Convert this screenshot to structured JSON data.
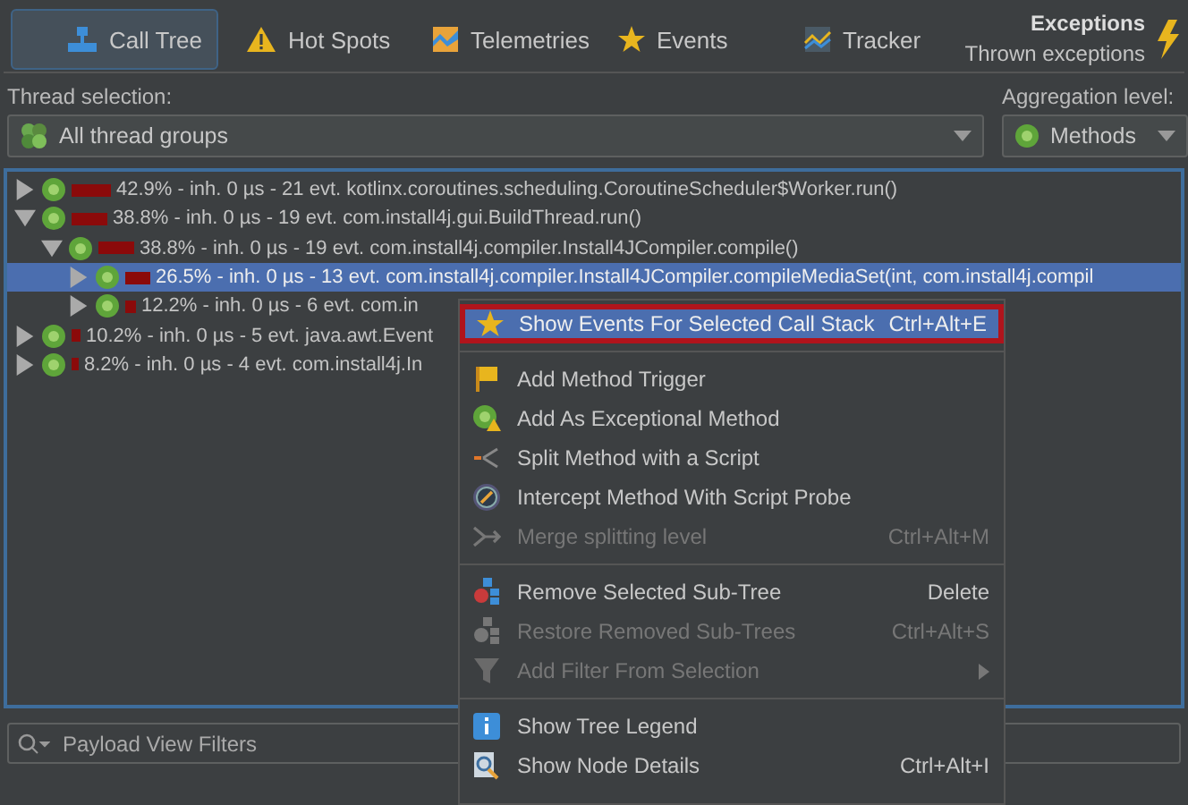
{
  "toolbar": {
    "tabs": [
      {
        "label": "Call Tree",
        "selected": true
      },
      {
        "label": "Hot Spots",
        "selected": false
      },
      {
        "label": "Telemetries",
        "selected": false
      },
      {
        "label": "Events",
        "selected": false
      },
      {
        "label": "Tracker",
        "selected": false
      }
    ],
    "exceptions": {
      "title": "Exceptions",
      "subtitle": "Thrown exceptions"
    }
  },
  "thread_selection": {
    "label": "Thread selection:",
    "value": "All thread groups"
  },
  "aggregation_level": {
    "label": "Aggregation level:",
    "value": "Methods"
  },
  "call_tree": [
    {
      "text": "42.9% - inh. 0 µs - 21 evt. kotlinx.coroutines.scheduling.CoroutineScheduler$Worker.run()",
      "expanded": false,
      "selected": false
    },
    {
      "text": "38.8% - inh. 0 µs - 19 evt. com.install4j.gui.BuildThread.run()",
      "expanded": true,
      "selected": false,
      "children": [
        {
          "text": "38.8% - inh. 0 µs - 19 evt. com.install4j.compiler.Install4JCompiler.compile()",
          "expanded": true,
          "selected": false,
          "children": [
            {
              "text": "26.5% - inh. 0 µs - 13 evt. com.install4j.compiler.Install4JCompiler.compileMediaSet(int, com.install4j.compil",
              "expanded": false,
              "selected": true
            },
            {
              "text": "12.2% - inh. 0 µs - 6 evt. com.in",
              "expanded": false,
              "selected": false
            }
          ]
        }
      ]
    },
    {
      "text": "10.2% - inh. 0 µs - 5 evt. java.awt.Event",
      "expanded": false,
      "selected": false
    },
    {
      "text": "8.2% - inh. 0 µs - 4 evt. com.install4j.In",
      "expanded": false,
      "selected": false
    }
  ],
  "context_menu": [
    {
      "kind": "item",
      "label": "Show Events For Selected Call Stack",
      "shortcut": "Ctrl+Alt+E",
      "selected": true,
      "disabled": false,
      "submenu": false
    },
    {
      "kind": "separator"
    },
    {
      "kind": "item",
      "label": "Add Method Trigger",
      "selected": false,
      "disabled": false,
      "submenu": false
    },
    {
      "kind": "item",
      "label": "Add As Exceptional Method",
      "selected": false,
      "disabled": false,
      "submenu": false
    },
    {
      "kind": "item",
      "label": "Split Method with a Script",
      "selected": false,
      "disabled": false,
      "submenu": false
    },
    {
      "kind": "item",
      "label": "Intercept Method With Script Probe",
      "selected": false,
      "disabled": false,
      "submenu": false
    },
    {
      "kind": "item",
      "label": "Merge splitting level",
      "shortcut": "Ctrl+Alt+M",
      "selected": false,
      "disabled": true,
      "submenu": false
    },
    {
      "kind": "separator"
    },
    {
      "kind": "item",
      "label": "Remove Selected Sub-Tree",
      "shortcut": "Delete",
      "selected": false,
      "disabled": false,
      "submenu": false
    },
    {
      "kind": "item",
      "label": "Restore Removed Sub-Trees",
      "shortcut": "Ctrl+Alt+S",
      "selected": false,
      "disabled": true,
      "submenu": false
    },
    {
      "kind": "item",
      "label": "Add Filter From Selection",
      "selected": false,
      "disabled": true,
      "submenu": true
    },
    {
      "kind": "separator"
    },
    {
      "kind": "item",
      "label": "Show Tree Legend",
      "selected": false,
      "disabled": false,
      "submenu": false
    },
    {
      "kind": "item",
      "label": "Show Node Details",
      "shortcut": "Ctrl+Alt+I",
      "selected": false,
      "disabled": false,
      "submenu": false
    }
  ],
  "payload_filter": {
    "placeholder": "Payload View Filters"
  }
}
